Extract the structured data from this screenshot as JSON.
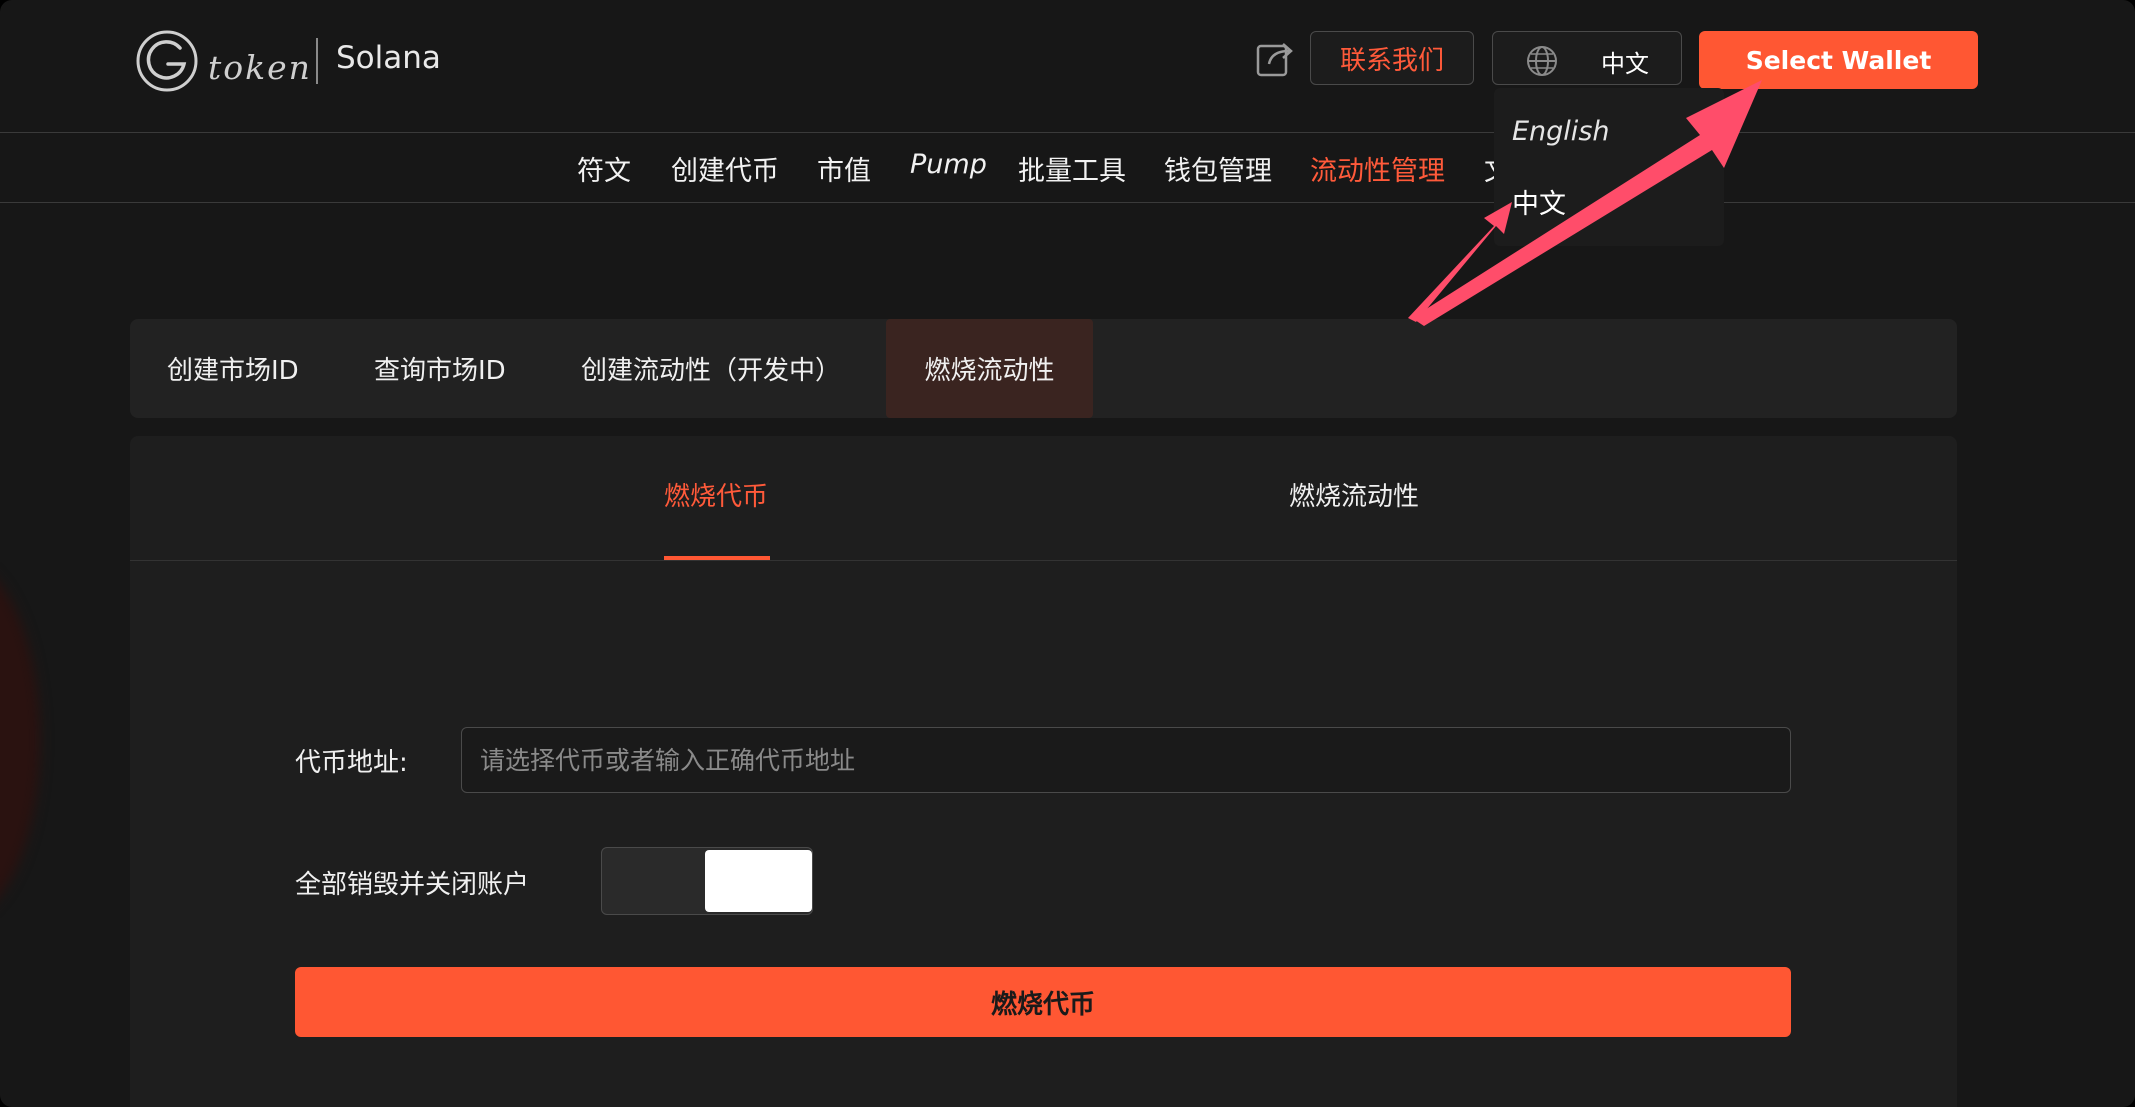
{
  "header": {
    "logo_text": "token",
    "chain_name": "Solana",
    "share_icon": "share-icon",
    "contact_label": "联系我们",
    "language_current": "中文",
    "globe_icon": "globe-icon",
    "wallet_label": "Select Wallet"
  },
  "language_menu": {
    "options": [
      "English",
      "中文"
    ]
  },
  "nav": {
    "items": [
      "符文",
      "创建代币",
      "市值",
      "Pump",
      "批量工具",
      "钱包管理",
      "流动性管理",
      "文"
    ],
    "active": "流动性管理"
  },
  "subtabs": {
    "items": [
      "创建市场ID",
      "查询市场ID",
      "创建流动性（开发中）",
      "燃烧流动性"
    ],
    "active": "燃烧流动性"
  },
  "panel": {
    "tabs": [
      "燃烧代币",
      "燃烧流动性"
    ],
    "active_tab": "燃烧代币",
    "address_label": "代币地址:",
    "address_placeholder": "请选择代币或者输入正确代币地址",
    "address_value": "",
    "close_account_label": "全部销毁并关闭账户",
    "close_account_enabled": false,
    "submit_label": "燃烧代币"
  },
  "colors": {
    "accent": "#ff5733",
    "background": "#171717",
    "annotation_arrow": "#ff4d6a"
  }
}
